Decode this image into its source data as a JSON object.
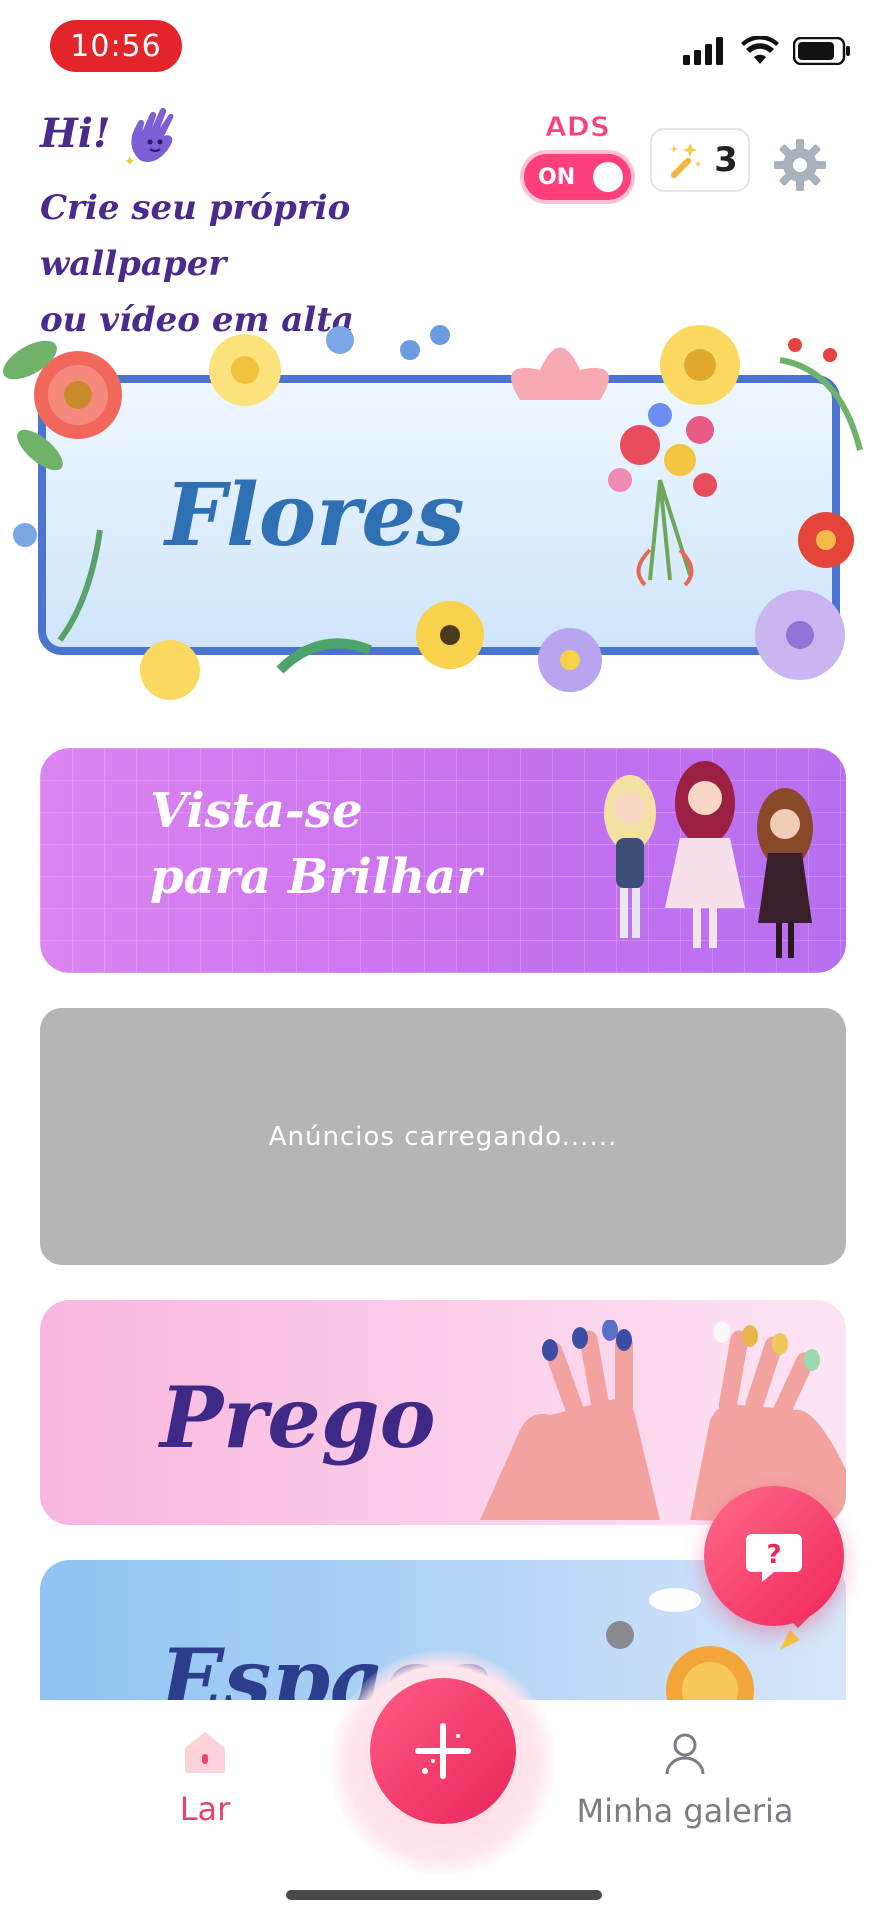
{
  "status_bar": {
    "time": "10:56"
  },
  "header": {
    "greeting": "Hi!",
    "subtitle_line1": "Crie seu próprio wallpaper",
    "subtitle_line2": "ou vídeo em alta",
    "ads_label": "ADS",
    "ads_toggle_state": "ON",
    "credits_count": "3"
  },
  "banners": {
    "flores": "Flores",
    "vista_line1": "Vista-se",
    "vista_line2": "para Brilhar",
    "ad_loading": "Anúncios carregando......",
    "prego": "Prego",
    "espaco": "Espaço"
  },
  "help": {
    "icon_text": "?"
  },
  "bottom_nav": {
    "home_label": "Lar",
    "gallery_label": "Minha galeria"
  },
  "colors": {
    "accent": "#e8456b",
    "brand_purple": "#4a2b8c",
    "ads_pink": "#ff3f79"
  }
}
